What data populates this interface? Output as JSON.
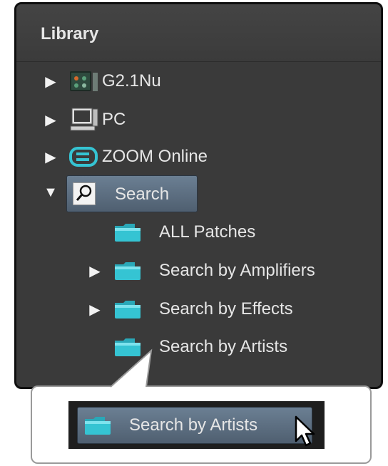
{
  "panel": {
    "title": "Library"
  },
  "tree": {
    "g2": {
      "label": "G2.1Nu"
    },
    "pc": {
      "label": "PC"
    },
    "zoom_online": {
      "label": "ZOOM Online"
    },
    "search": {
      "label": "Search"
    },
    "children": [
      {
        "label": "ALL Patches",
        "expandable": false
      },
      {
        "label": "Search by Amplifiers",
        "expandable": true
      },
      {
        "label": "Search by Effects",
        "expandable": true
      },
      {
        "label": "Search by Artists",
        "expandable": false
      }
    ]
  },
  "callout": {
    "selected_label": "Search by Artists"
  },
  "colors": {
    "panel_bg": "#3a3a3a",
    "selection": "#5a6b7d",
    "folder": "#35c4d3",
    "text": "#e6e6e6"
  }
}
